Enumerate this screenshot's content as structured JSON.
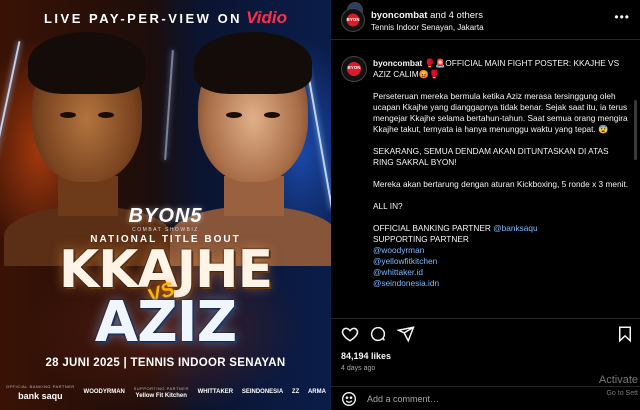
{
  "poster": {
    "banner_text": "LIVE PAY-PER-VIEW ON",
    "banner_brand": "Vidio",
    "logo": "BYON5",
    "logo_sub": "COMBAT SHOWBIZ",
    "bout_label": "NATIONAL TITLE BOUT",
    "fighter1": "KKAJHE",
    "vs": "VS",
    "fighter2": "AZIZ",
    "event_line": "28 JUNI 2025 | TENNIS INDOOR SENAYAN",
    "sponsors": {
      "banking_caption": "OFFICIAL BANKING PARTNER",
      "bank": "bank saqu",
      "supporting_caption": "SUPPORTING PARTNER",
      "partners": [
        "WOODYRMAN",
        "Yellow Fit Kitchen",
        "WHITTAKER",
        "SEINDONESIA",
        "ZZ",
        "ARMA"
      ]
    }
  },
  "header": {
    "account": "byoncombat",
    "others": "and 4 others",
    "location": "Tennis Indoor Senayan, Jakarta",
    "more_icon": "more-horizontal-icon"
  },
  "caption": {
    "avatar_text": "BYON",
    "username": "byoncombat",
    "headline": "🥊🚨OFFICIAL MAIN FIGHT POSTER: KKAJHE VS AZIZ CALIM😡🥊",
    "p1": "Perseteruan mereka bermula ketika Aziz merasa tersinggung oleh ucapan Kkajhe yang dianggapnya tidak benar. Sejak saat itu, ia terus mengejar Kkajhe selama bertahun-tahun. Saat semua orang mengira Kkajhe takut, ternyata ia hanya menunggu waktu yang tepat. 😨",
    "p2": "SEKARANG, SEMUA DENDAM AKAN DITUNTASKAN DI ATAS RING SAKRAL BYON!",
    "p3": "Mereka akan bertarung dengan aturan Kickboxing, 5 ronde x 3 menit.",
    "p4": "ALL IN?",
    "banking_label": "OFFICIAL BANKING PARTNER",
    "banking_handle": "@banksaqu",
    "supporting_label": "SUPPORTING PARTNER",
    "partner_handles": [
      "@woodyrman",
      "@yellowfitkitchen",
      "@whittaker.id",
      "@seindonesia.idn"
    ]
  },
  "actions": {
    "likes": "84,194 likes",
    "time_ago": "4 days ago"
  },
  "comment": {
    "placeholder": "Add a comment…"
  },
  "watermark": {
    "line1": "Activate",
    "line2": "Go to Sett"
  },
  "colors": {
    "accent_red": "#d81c2c",
    "link_blue": "#79b8ff",
    "vidio_red": "#ff2f4a"
  }
}
